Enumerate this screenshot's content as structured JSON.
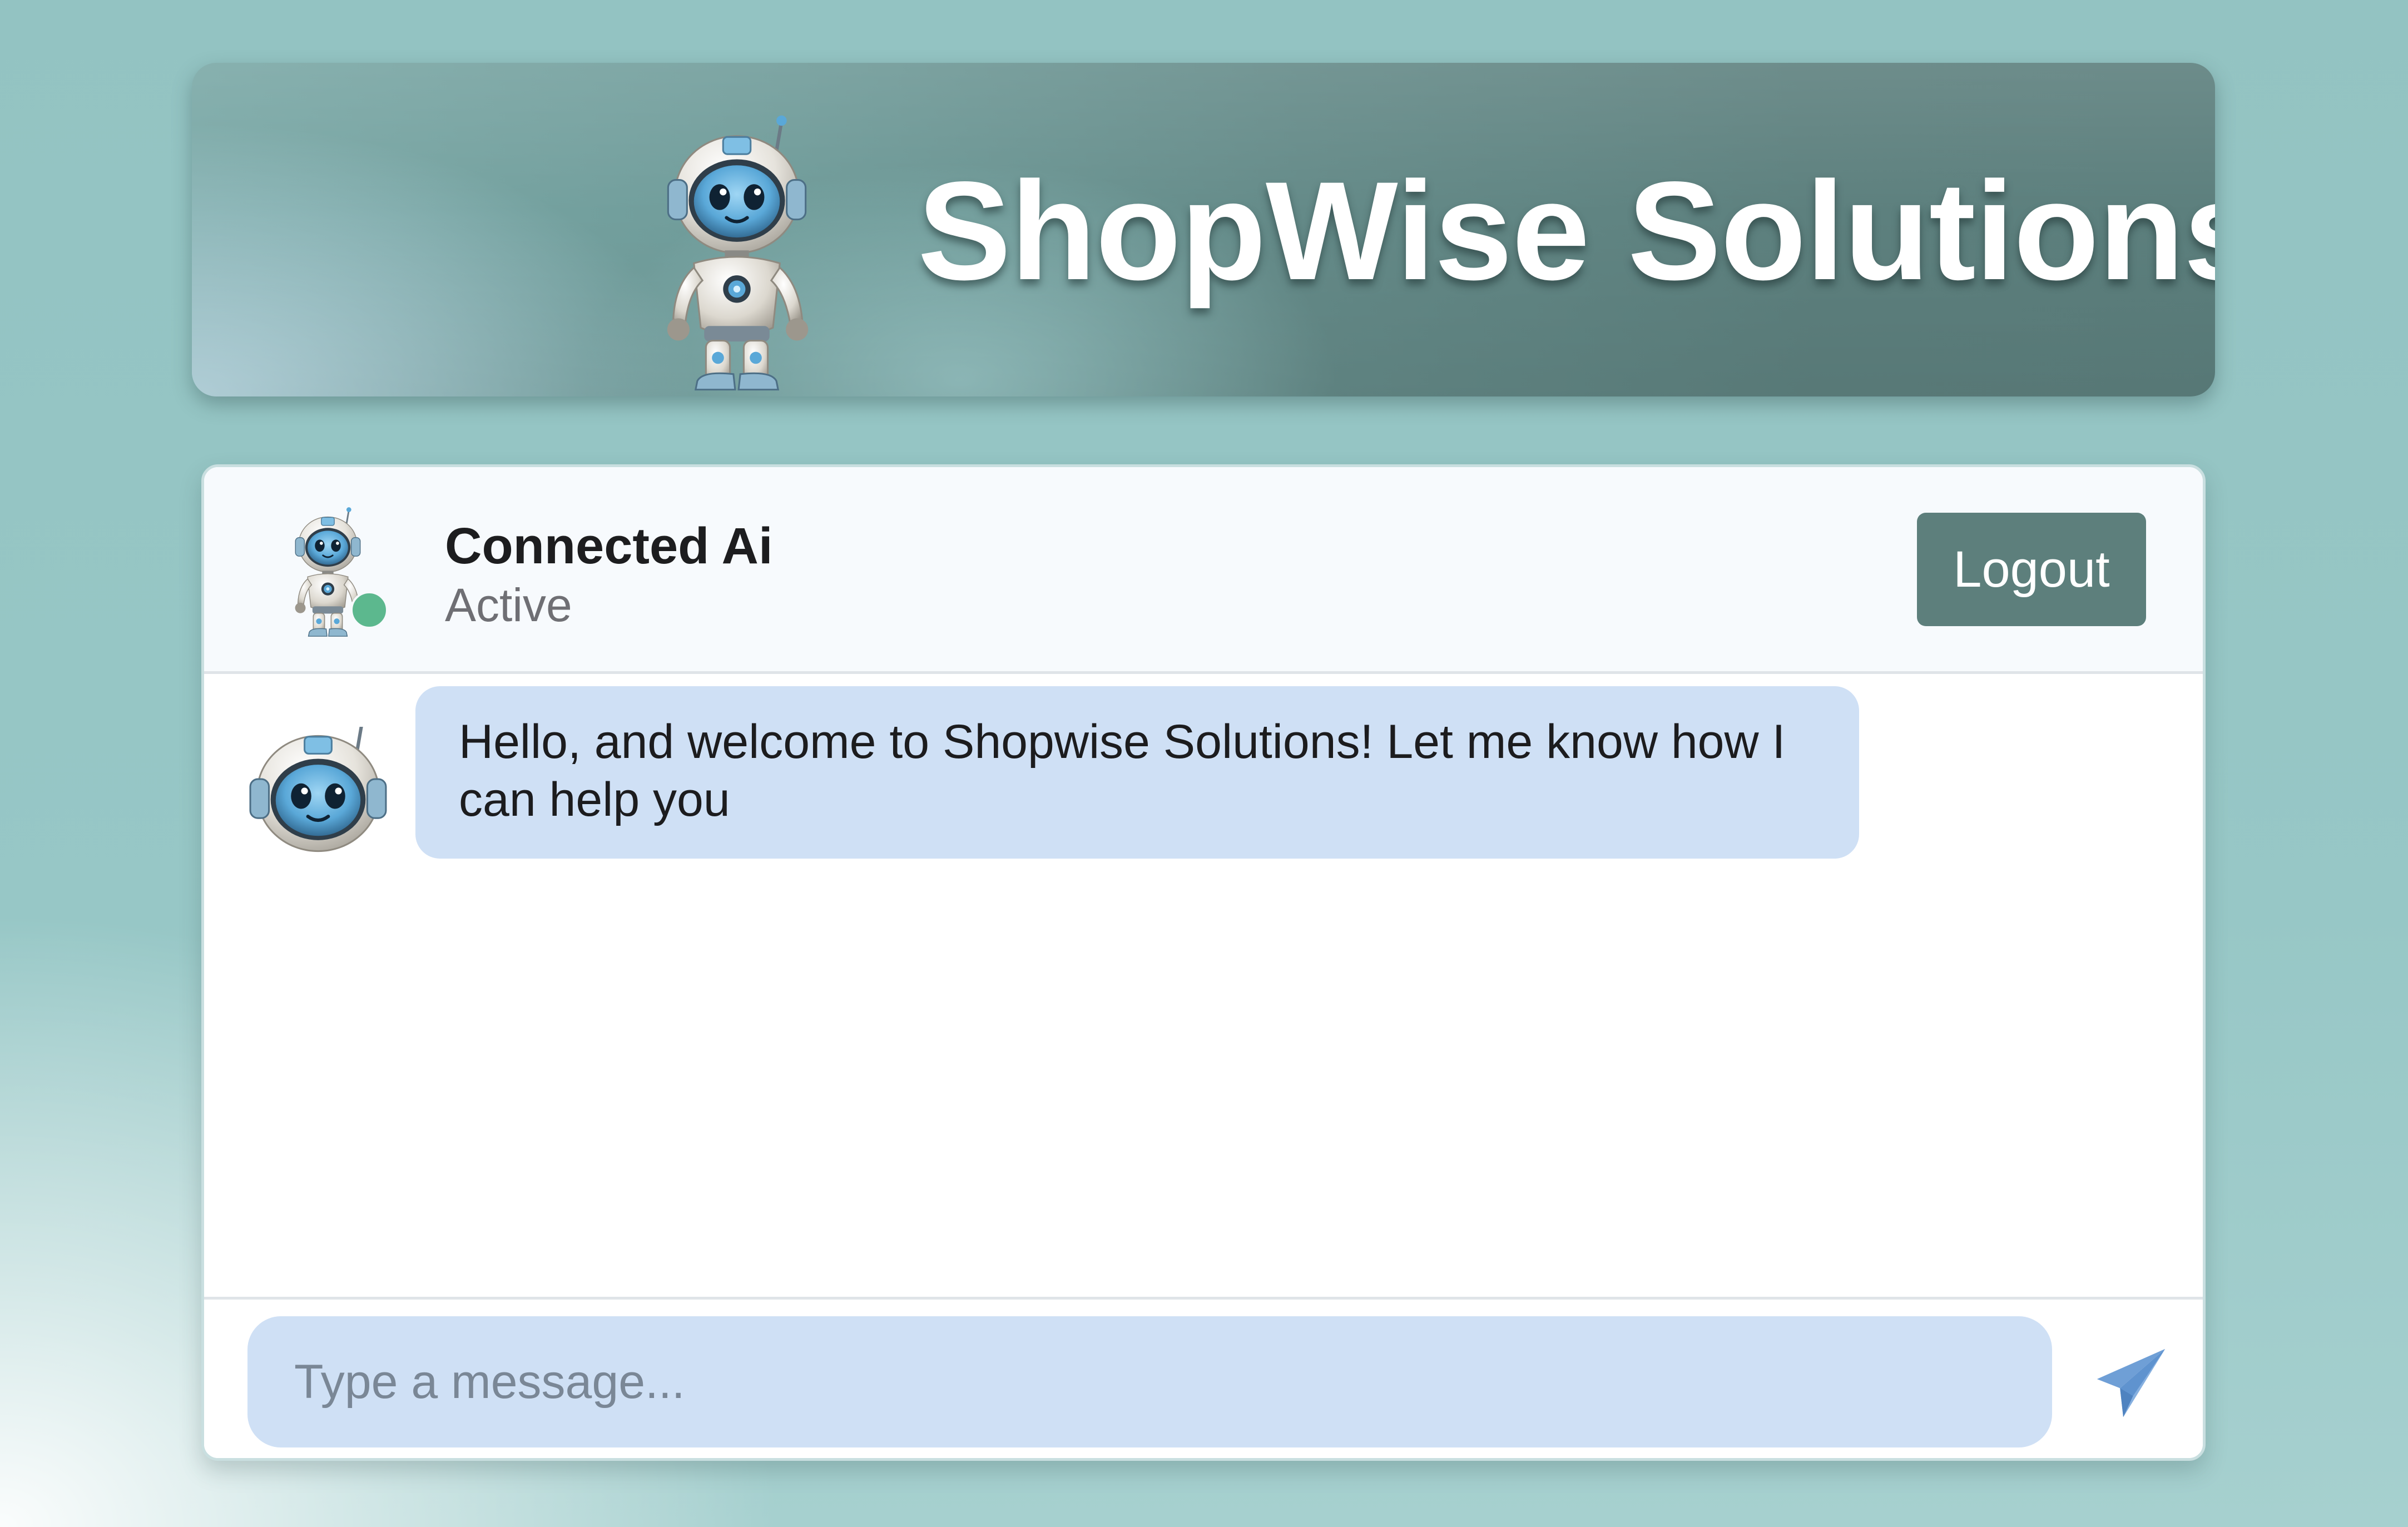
{
  "header": {
    "title": "ShopWise Solutions",
    "logo_icon": "robot-mascot-icon"
  },
  "chat": {
    "agent": {
      "name": "Connected Ai",
      "status": "Active",
      "avatar_icon": "robot-avatar-icon",
      "status_color": "#5cb88e"
    },
    "logout_label": "Logout",
    "messages": [
      {
        "sender": "bot",
        "text": "Hello, and welcome to Shopwise Solutions! Let me know how I can help you"
      }
    ],
    "composer": {
      "placeholder": "Type a message...",
      "value": "",
      "send_icon": "paper-plane-icon"
    }
  },
  "colors": {
    "accent": "#5d7f7c",
    "bubble": "#cfe0f5",
    "send_icon": "#6f9fd6"
  }
}
